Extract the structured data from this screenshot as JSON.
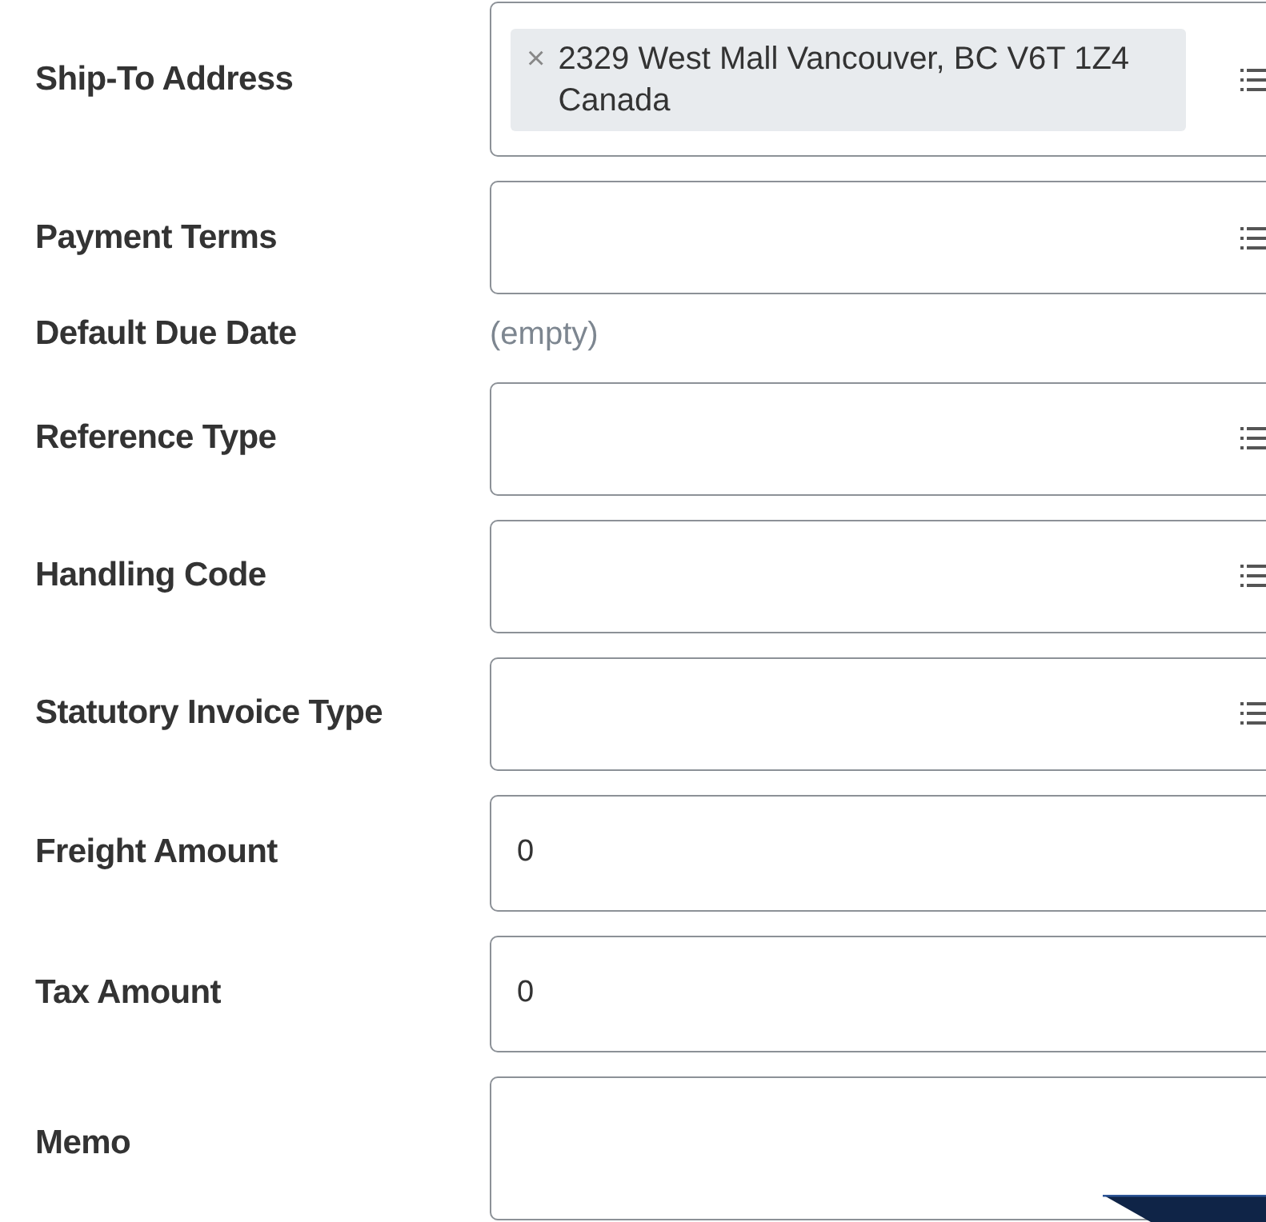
{
  "fields": [
    {
      "label": "Ship-To Address",
      "kind": "select",
      "chips": [
        {
          "remove": "×",
          "text": "2329 West Mall Vancouver, BC V6T 1Z4 Canada"
        }
      ]
    },
    {
      "label": "Payment Terms",
      "kind": "select"
    },
    {
      "label": "Default Due Date",
      "kind": "readonly",
      "value": "(empty)"
    },
    {
      "label": "Reference Type",
      "kind": "select"
    },
    {
      "label": "Handling Code",
      "kind": "select"
    },
    {
      "label": "Statutory Invoice Type",
      "kind": "select"
    },
    {
      "label": "Freight Amount",
      "kind": "text",
      "value": "0"
    },
    {
      "label": "Tax Amount",
      "kind": "text",
      "value": "0"
    },
    {
      "label": "Memo",
      "kind": "textarea"
    }
  ]
}
